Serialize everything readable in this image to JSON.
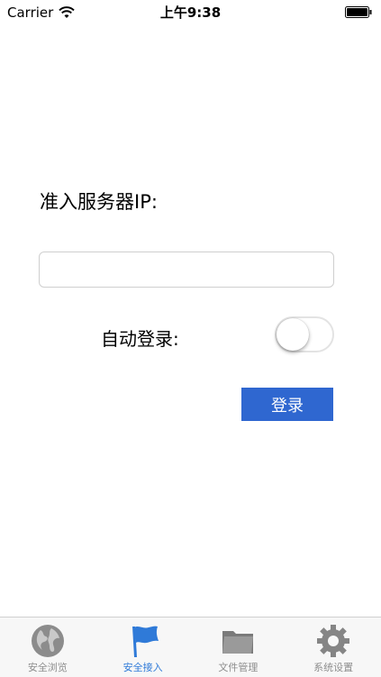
{
  "status_bar": {
    "carrier": "Carrier",
    "time": "上午9:38",
    "wifi_icon": "wifi-icon",
    "battery_icon": "battery-icon"
  },
  "form": {
    "server_label": "准入服务器IP:",
    "server_input_value": "",
    "auto_login_label": "自动登录:",
    "auto_login_enabled": false,
    "login_button_label": "登录"
  },
  "tabs": [
    {
      "label": "安全浏览",
      "icon": "globe-icon",
      "active": false
    },
    {
      "label": "安全接入",
      "icon": "flag-icon",
      "active": true
    },
    {
      "label": "文件管理",
      "icon": "folder-icon",
      "active": false
    },
    {
      "label": "系统设置",
      "icon": "gear-icon",
      "active": false
    }
  ],
  "colors": {
    "accent": "#2f67d0",
    "tab_active": "#2f7ad8",
    "tab_inactive": "#8e8e8e"
  }
}
